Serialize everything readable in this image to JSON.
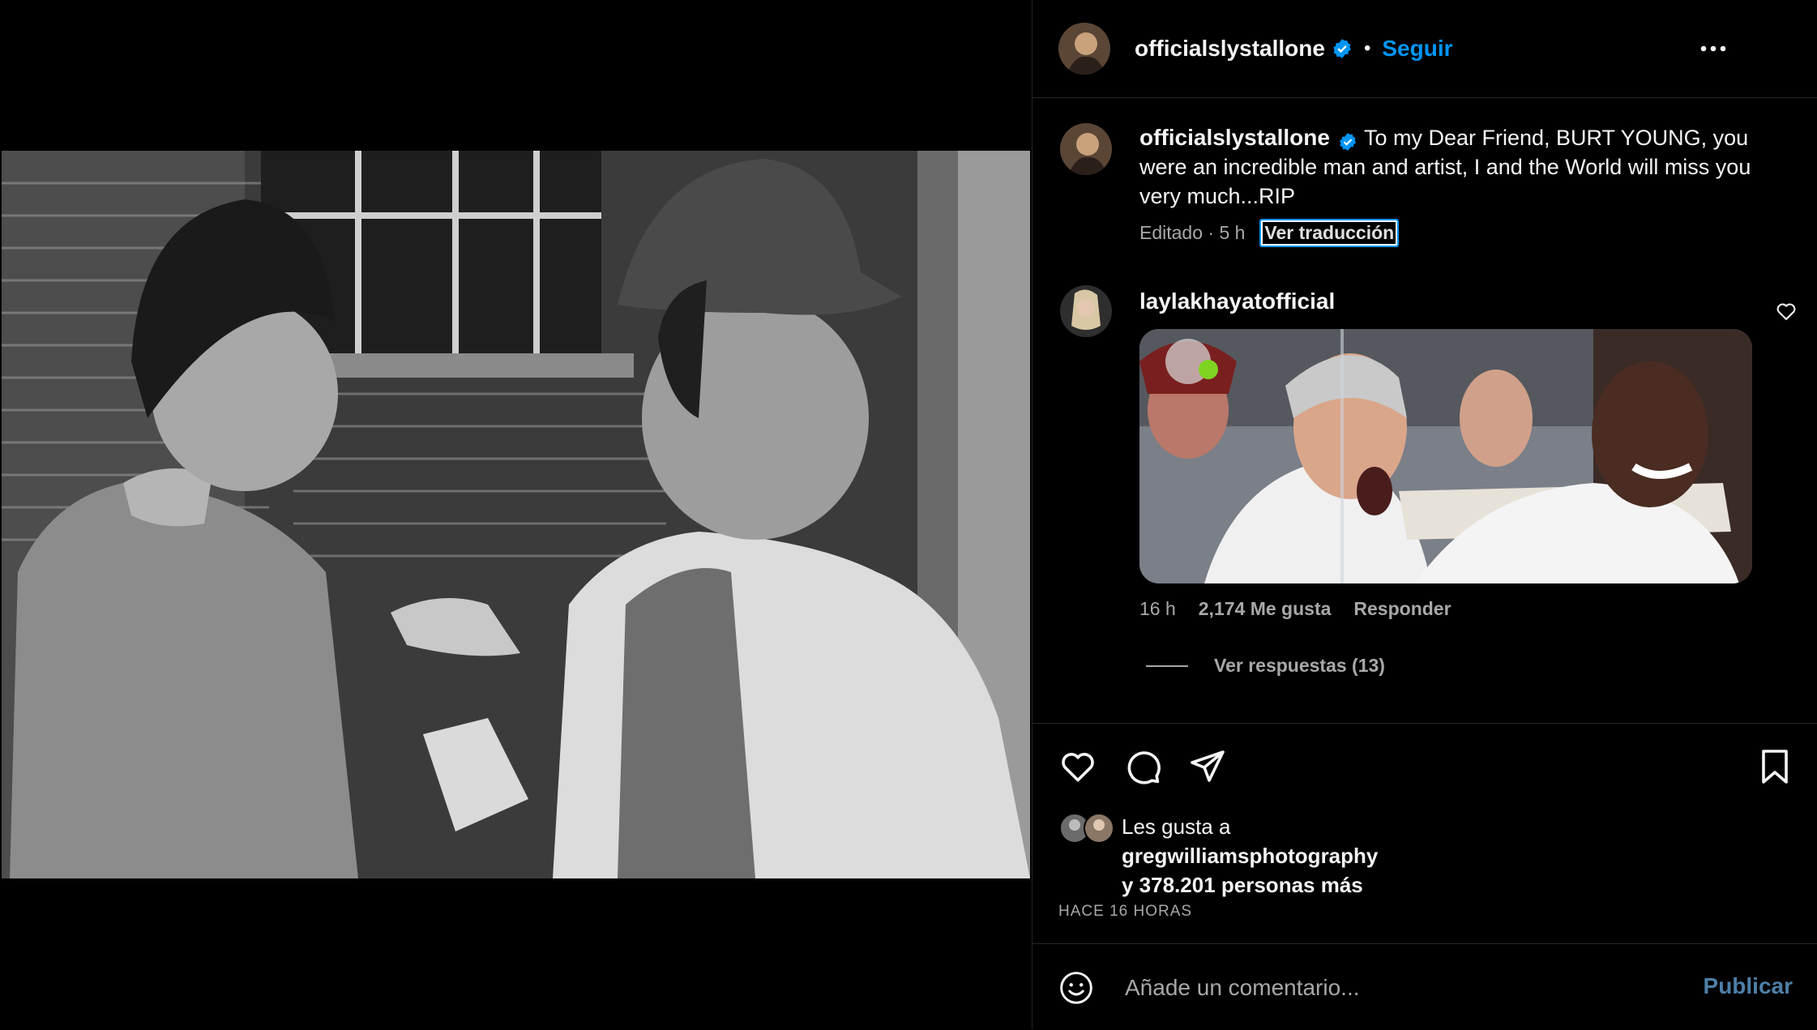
{
  "post": {
    "author": "officialslystallone",
    "follow_label": "Seguir",
    "separator": "•",
    "caption_author": "officialslystallone",
    "caption_text": "To my Dear Friend, BURT YOUNG, you were an incredible man and artist, I and the World will miss you very much...RIP",
    "caption_meta": "Editado · 5 h",
    "translate_label": "Ver traducción"
  },
  "comment": {
    "author": "laylakhayatofficial",
    "time": "16 h",
    "likes": "2,174 Me gusta",
    "reply_label": "Responder",
    "view_replies": "Ver respuestas (13)"
  },
  "likes": {
    "prefix": "Les gusta a",
    "user": "gregwilliamsphotography",
    "rest": "y 378.201 personas más"
  },
  "timestamp": "HACE 16 HORAS",
  "comment_input": {
    "placeholder": "Añade un comentario...",
    "publish_label": "Publicar"
  },
  "colors": {
    "accent": "#0095f6",
    "background": "#000000",
    "divider": "#262626",
    "muted": "#a8a8a8"
  },
  "icons": [
    "more-options-icon",
    "verified-badge-icon",
    "heart-icon",
    "comment-icon",
    "share-icon",
    "bookmark-icon",
    "emoji-icon",
    "comment-like-icon"
  ]
}
